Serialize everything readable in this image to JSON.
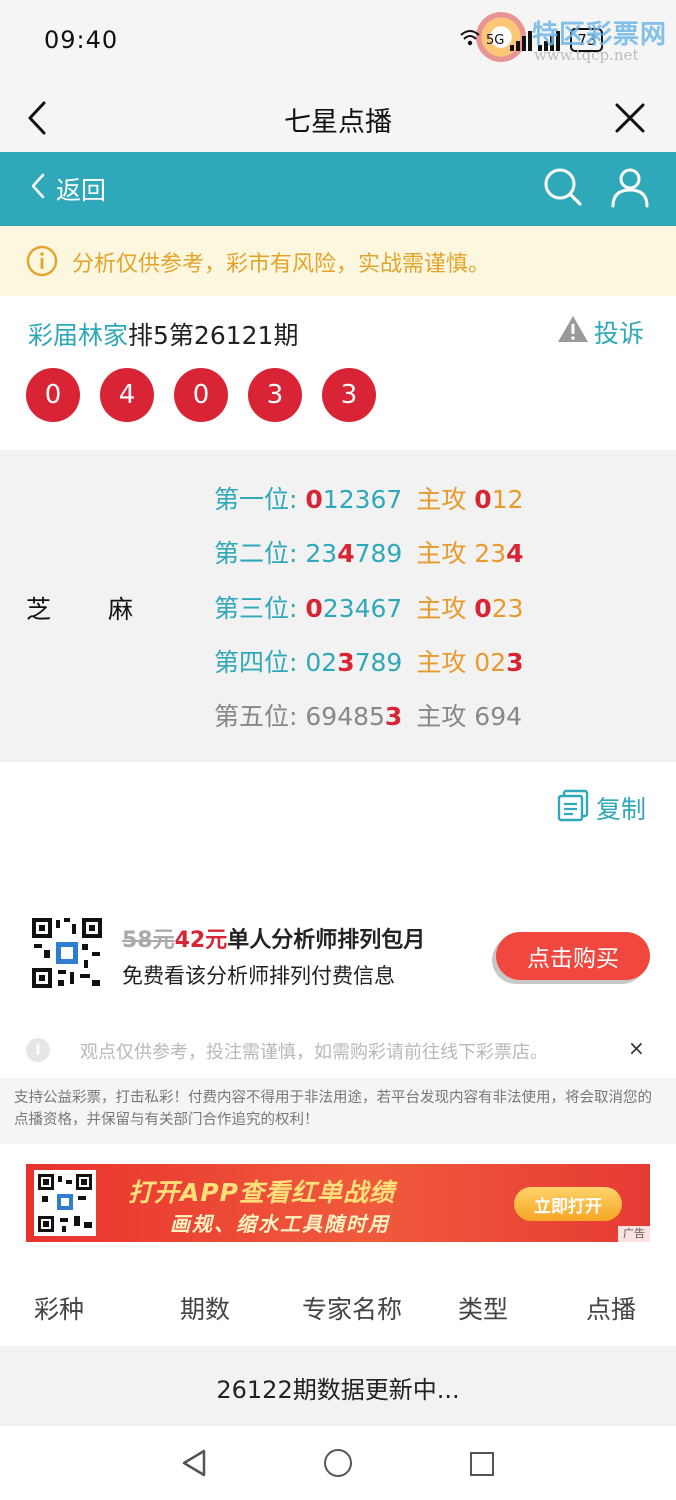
{
  "status_bar": {
    "time": "09:40",
    "network": "5G",
    "battery": "73",
    "watermark_title": "特区彩票网",
    "watermark_url": "www.tqcp.net"
  },
  "titlebar": {
    "title": "七星点播"
  },
  "header": {
    "back_label": "返回"
  },
  "warning": {
    "text": "分析仅供参考，彩市有风险，实战需谨慎。"
  },
  "record": {
    "expert": "彩届林家",
    "issue_text": "排5第26121期",
    "complain_label": "投诉",
    "balls": [
      "0",
      "4",
      "0",
      "3",
      "3"
    ]
  },
  "analysis": {
    "label_a": "芝",
    "label_b": "麻",
    "rows": [
      {
        "pos": "第一位:",
        "d_hit": "0",
        "d_rest": "12367",
        "attack": "主攻",
        "a_hit": "0",
        "a_rest": "12"
      },
      {
        "pos": "第二位:",
        "d_pre": "23",
        "d_hit": "4",
        "d_post": "789",
        "attack": "主攻",
        "a_pre": "23",
        "a_hit": "4"
      },
      {
        "pos": "第三位:",
        "d_hit": "0",
        "d_rest": "23467",
        "attack": "主攻",
        "a_hit": "0",
        "a_rest": "23"
      },
      {
        "pos": "第四位:",
        "d_pre": "02",
        "d_hit": "3",
        "d_post": "789",
        "attack": "主攻",
        "a_pre": "02",
        "a_hit": "3"
      },
      {
        "pos": "第五位:",
        "d_pre": "69485",
        "d_hit": "3",
        "attack": "主攻",
        "a_pre": "694"
      }
    ]
  },
  "copy_label": "复制",
  "purchase": {
    "old_price": "58元",
    "new_price": "42元",
    "title": "单人分析师排列包月",
    "subtitle": "免费看该分析师排列付费信息",
    "button": "点击购买"
  },
  "notice": {
    "text": "观点仅供参考，投注需谨慎，如需购彩请前往线下彩票店。",
    "close": "×"
  },
  "legal": "支持公益彩票，打击私彩！付费内容不得用于非法用途，若平台发现内容有非法使用，将会取消您的点播资格，并保留与有关部门合作追究的权利！",
  "banner": {
    "line1": "打开APP查看红单战绩",
    "line2": "画规、缩水工具随时用",
    "button": "立即打开",
    "ad_tag": "广告"
  },
  "table": {
    "headers": [
      "彩种",
      "期数",
      "专家名称",
      "类型",
      "点播"
    ],
    "status_row": "26122期数据更新中..."
  },
  "colors": {
    "teal": "#2fa8b9",
    "red": "#d82434",
    "orange": "#e89b2d",
    "warn_bg": "#fdf7e0"
  }
}
